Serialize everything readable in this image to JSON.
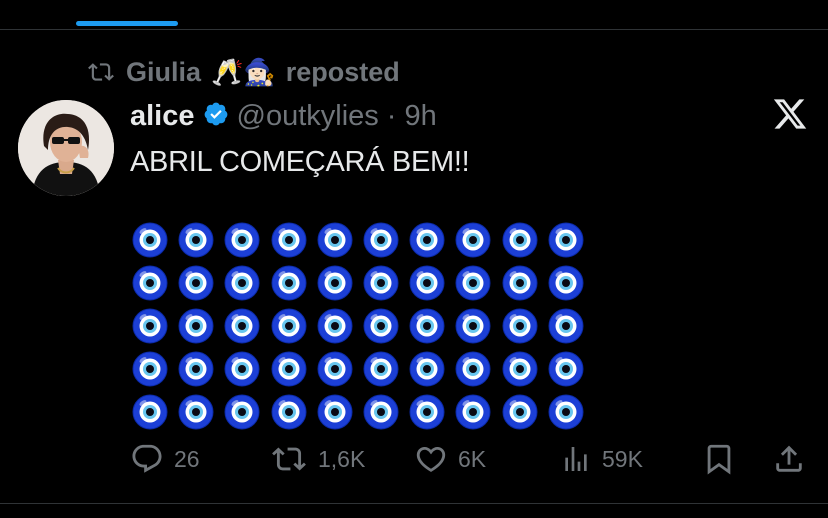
{
  "repost": {
    "user": "Giulia",
    "emoji": "🥂🧙🏻‍♀️",
    "label": "reposted"
  },
  "tweet": {
    "display_name": "alice",
    "verified": true,
    "handle": "@outkylies",
    "separator": "·",
    "time": "9h",
    "text": "ABRIL COMEÇARÁ BEM!!",
    "emoji_grid": {
      "emoji": "🧿",
      "name": "nazar-amulet",
      "rows": 5,
      "cols": 10
    }
  },
  "actions": {
    "replies": "26",
    "reposts": "1,6K",
    "likes": "6K",
    "views": "59K"
  },
  "colors": {
    "background": "#000000",
    "accent": "#1d9bf0",
    "muted": "#71767b",
    "text": "#e7e9ea",
    "divider": "#2f3336"
  },
  "icons": [
    "repost-icon",
    "verified-badge-icon",
    "x-logo-icon",
    "reply-icon",
    "repost-icon",
    "like-icon",
    "views-icon",
    "bookmark-icon",
    "share-icon"
  ]
}
